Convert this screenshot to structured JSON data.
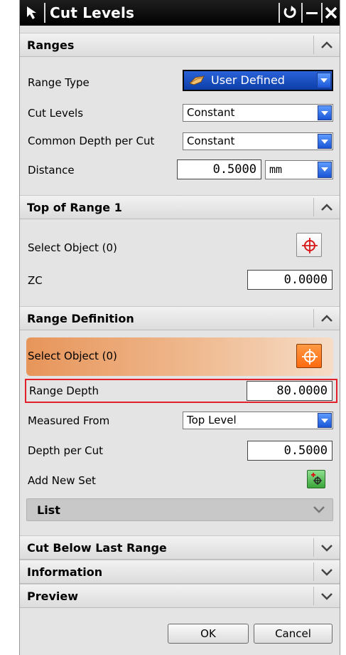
{
  "window": {
    "title": "Cut Levels"
  },
  "sections": {
    "ranges": {
      "title": "Ranges",
      "range_type_label": "Range Type",
      "range_type_value": "User Defined",
      "cut_levels_label": "Cut Levels",
      "cut_levels_value": "Constant",
      "common_depth_label": "Common Depth per Cut",
      "common_depth_value": "Constant",
      "distance_label": "Distance",
      "distance_value": "0.5000",
      "distance_unit": "mm"
    },
    "top_of_range": {
      "title": "Top of Range 1",
      "select_object_label": "Select Object (0)",
      "zc_label": "ZC",
      "zc_value": "0.0000"
    },
    "range_definition": {
      "title": "Range Definition",
      "select_object_label": "Select Object (0)",
      "range_depth_label": "Range Depth",
      "range_depth_value": "80.0000",
      "measured_from_label": "Measured From",
      "measured_from_value": "Top Level",
      "depth_per_cut_label": "Depth per Cut",
      "depth_per_cut_value": "0.5000",
      "add_new_set_label": "Add New Set",
      "list_label": "List"
    },
    "cut_below": {
      "title": "Cut Below Last Range"
    },
    "information": {
      "title": "Information"
    },
    "preview": {
      "title": "Preview"
    }
  },
  "buttons": {
    "ok": "OK",
    "cancel": "Cancel"
  },
  "colors": {
    "highlight_border": "#e0202a",
    "accent_blue": "#1a56d6",
    "select_gradient_start": "#e8a064",
    "crosshair_red": "#d81818"
  }
}
